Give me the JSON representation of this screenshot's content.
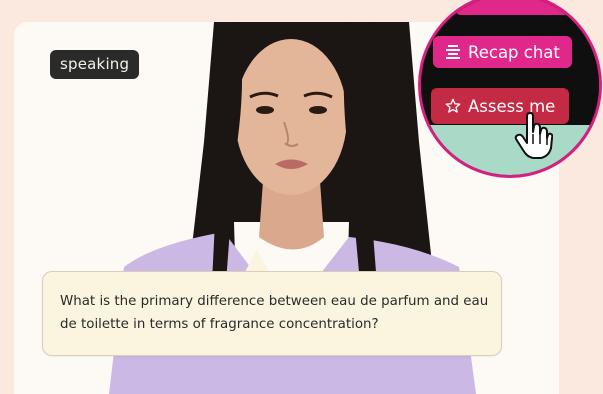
{
  "status_badge": "speaking",
  "question": "What is the primary difference between eau de parfum and eau de toilette in terms of fragrance concentration?",
  "zoom": {
    "recap_label": "Recap chat",
    "assess_label": "Assess me",
    "recap_icon": "list-icon",
    "assess_icon": "star-icon",
    "cursor_icon": "hand-pointer-icon"
  },
  "colors": {
    "page_bg": "#fbe9e0",
    "accent_pink": "#e0288a",
    "assess_red": "#c52a45",
    "zoom_border": "#d61f7f",
    "bubble_bg": "#fbf4df"
  }
}
